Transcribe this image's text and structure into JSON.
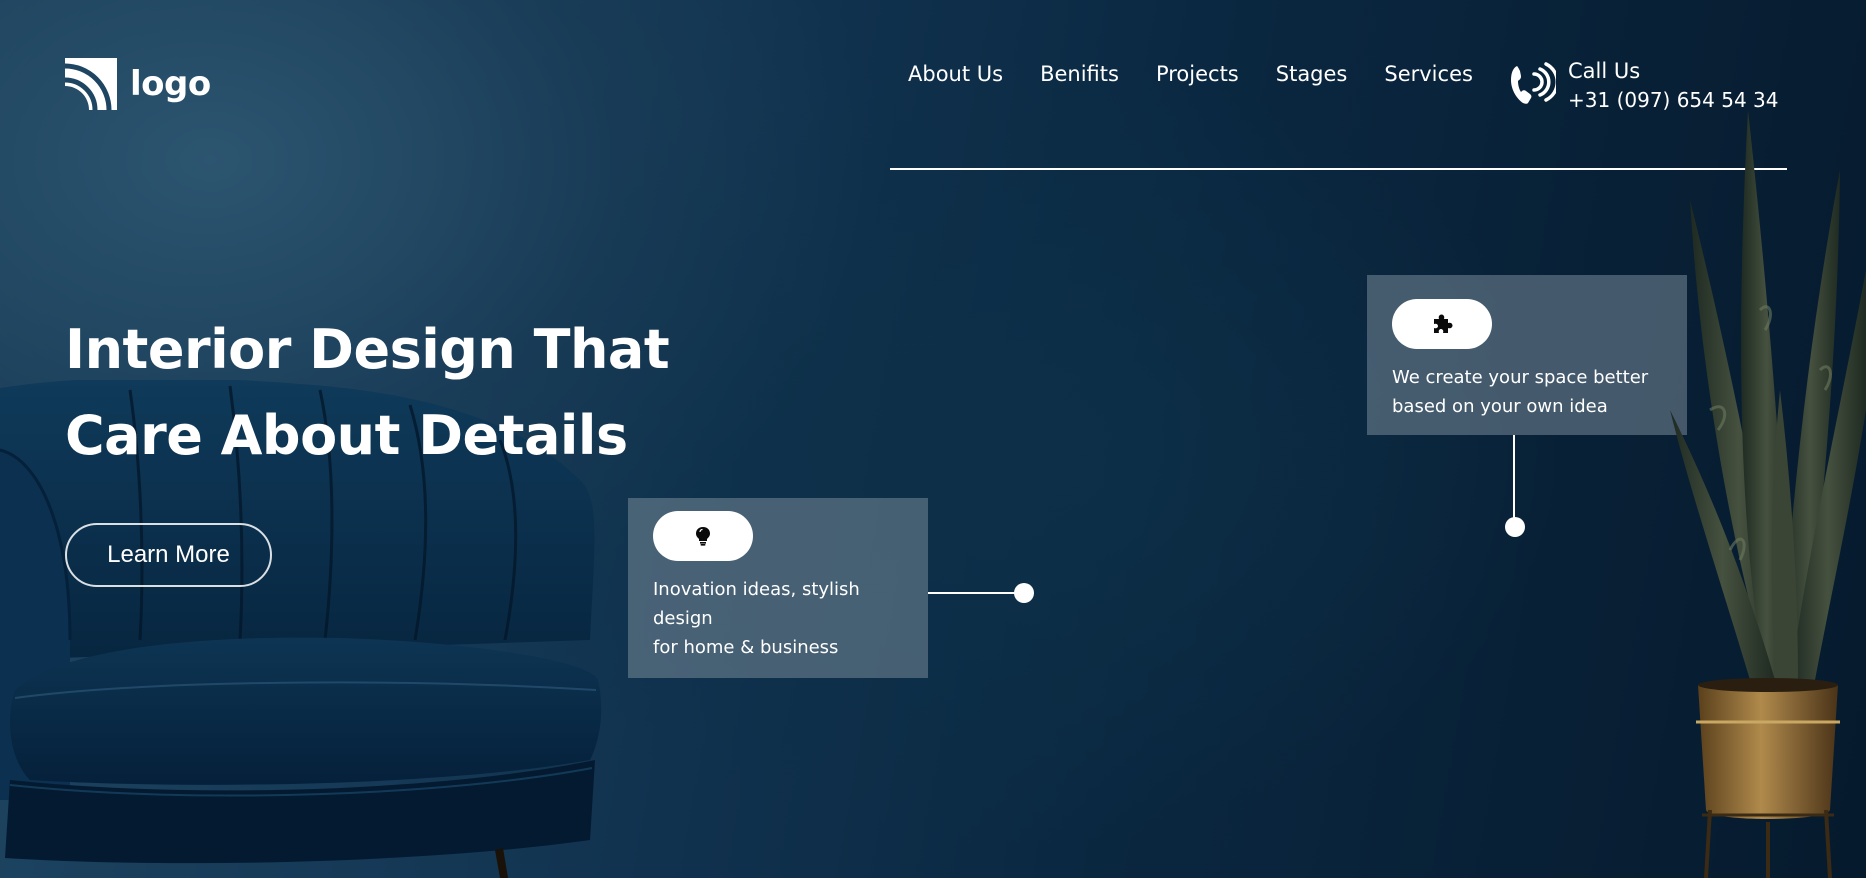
{
  "brand": {
    "logo_text": "logo",
    "logo_icon": "signal-arcs-icon"
  },
  "nav": {
    "items": [
      {
        "label": "About Us"
      },
      {
        "label": "Benifits"
      },
      {
        "label": "Projects"
      },
      {
        "label": "Stages"
      },
      {
        "label": "Services"
      }
    ]
  },
  "contact": {
    "icon": "phone-icon",
    "label": "Call Us",
    "phone": "+31 (097) 654 54 34"
  },
  "hero": {
    "title_line1": "Interior Design That",
    "title_line2": "Care About Details",
    "cta_label": "Learn More"
  },
  "features": [
    {
      "icon": "lightbulb-icon",
      "line1": "Inovation ideas, stylish design",
      "line2": "for home & business"
    },
    {
      "icon": "puzzle-icon",
      "line1": "We create your space better",
      "line2": "based on your own idea"
    }
  ],
  "colors": {
    "background_dark": "#061a2d",
    "background_mid": "#113350",
    "background_light": "#2c5570",
    "text": "#ffffff",
    "card_bg": "#76889899",
    "chair": "#0a2e4a",
    "plant_leaf": "#2f3a30",
    "pot": "#9a7440"
  }
}
